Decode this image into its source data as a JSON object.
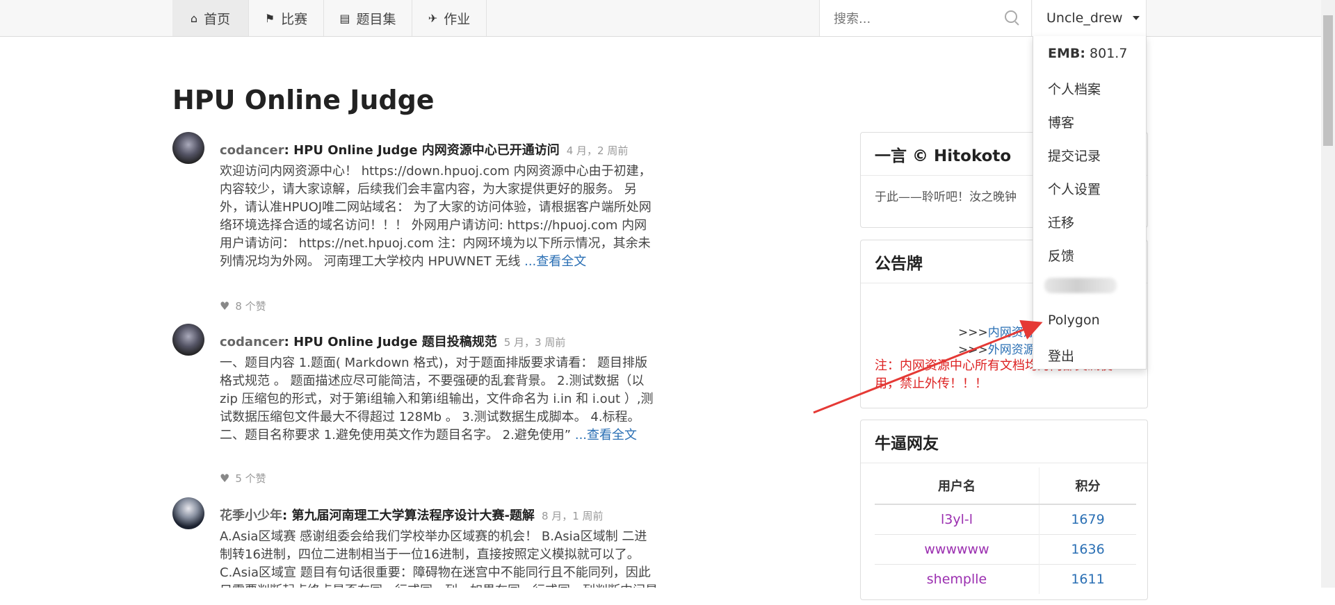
{
  "nav": {
    "items": [
      {
        "icon": "home-icon",
        "glyph": "⌂",
        "label": "首页"
      },
      {
        "icon": "flag-icon",
        "glyph": "⚑",
        "label": "比赛"
      },
      {
        "icon": "book-icon",
        "glyph": "▤",
        "label": "题目集"
      },
      {
        "icon": "plane-icon",
        "glyph": "✈",
        "label": "作业"
      }
    ],
    "search_placeholder": "搜索...",
    "user": "Uncle_drew"
  },
  "dropdown": {
    "emb_label": "EMB:",
    "emb_value": "801.7",
    "items": [
      "个人档案",
      "博客",
      "提交记录",
      "个人设置",
      "迁移",
      "反馈"
    ],
    "polygon": "Polygon",
    "logout": "登出"
  },
  "page_title": "HPU Online Judge",
  "posts": [
    {
      "author": "codancer",
      "title": ": HPU Online Judge 内网资源中心已开通访问",
      "time": "4 月，2 周前",
      "body": "欢迎访问内网资源中心！ https://down.hpuoj.com 内网资源中心由于初建，内容较少，请大家谅解，后续我们会丰富内容，为大家提供更好的服务。 另外，请认准HPUOJ唯二网站域名： 为了大家的访问体验，请根据客户端所处网络环境选择合适的域名访问！！！ 外网用户请访问: https://hpuoj.com 内网用户请访问： https://net.hpuoj.com 注：内网环境为以下所示情况，其余未列情况均为外网。 河南理工大学校内 HPUWNET 无线 ",
      "read_more": "...查看全文",
      "likes": "8 个赞"
    },
    {
      "author": "codancer",
      "title": ": HPU Online Judge 题目投稿规范",
      "time": "5 月，3 周前",
      "body": "一、题目内容 1.题面( Markdown 格式)，对于题面排版要求请看： 题目排版格式规范 。 题面描述应尽可能简洁，不要强硬的乱套背景。 2.测试数据（以 zip 压缩包的形式，对于第i组输入和第i组输出，文件命名为 i.in 和 i.out ）,测试数据压缩包文件最大不得超过 128Mb 。 3.测试数据生成脚本。 4.标程。 二、题目名称要求 1.避免使用英文作为题目名字。 2.避免使用” ",
      "read_more": "...查看全文",
      "likes": "5 个赞"
    },
    {
      "author": "花季小少年",
      "title": ": 第九届河南理工大学算法程序设计大赛-题解",
      "time": "8 月，1 周前",
      "body": "A.Asia区域赛 感谢组委会给我们学校举办区域赛的机会！ B.Asia区域制 二进制转16进制，四位二进制相当于一位16进制，直接按照定义模拟就可以了。 C.Asia区域宣 题目有句话很重要：障碍物在迷宫中不能同行且不能同列，因此只需要判断起点终点是否在同一行或同一列，如果在同一行或同一列判断中间是否有障碍物即可。"
    }
  ],
  "hitokoto": {
    "title": "一言 © Hitokoto",
    "text": "于此——聆听吧！汝之晚钟"
  },
  "notice": {
    "title": "公告牌",
    "line1_prefix": ">>>",
    "line1_link": "内网资源中心",
    "line2_prefix": ">>>",
    "line2_link": "外网资源中心",
    "warning": "注：内网资源中心所有文档均为内部交流使用，禁止外传！！！"
  },
  "ranking": {
    "title": "牛逼网友",
    "col_user": "用户名",
    "col_score": "积分",
    "rows": [
      {
        "user": "l3yl-l",
        "score": "1679"
      },
      {
        "user": "wwwwww",
        "score": "1636"
      },
      {
        "user": "shemplle",
        "score": "1611"
      }
    ]
  },
  "colors": {
    "link": "#2a6fb4",
    "username": "#9b2fb0",
    "warning": "#dd2222",
    "arrow": "#e53935"
  }
}
